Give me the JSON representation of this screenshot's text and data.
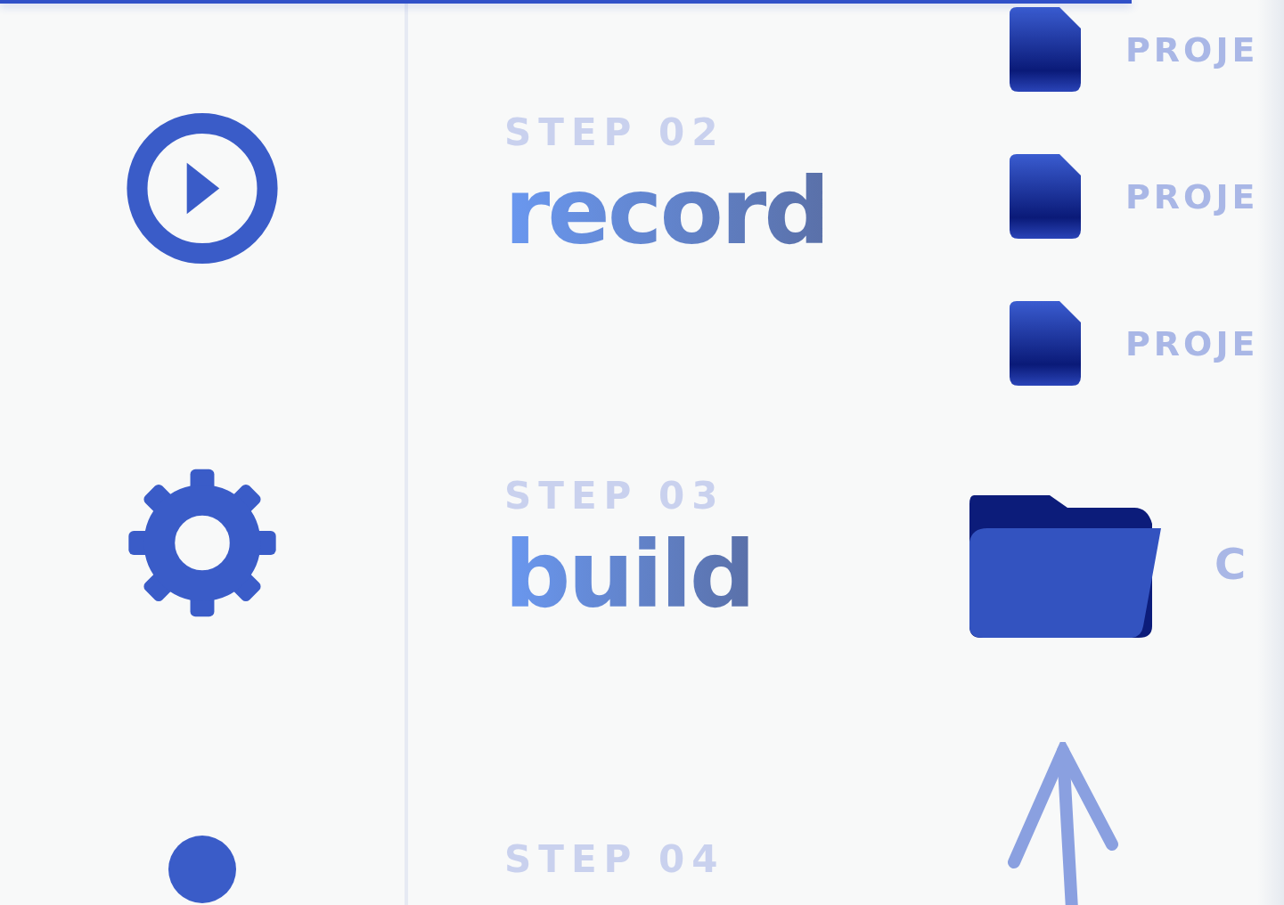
{
  "steps": [
    {
      "label": "STEP 02",
      "title": "record"
    },
    {
      "label": "STEP 03",
      "title": "build"
    },
    {
      "label": "STEP 04"
    }
  ],
  "files": [
    {
      "name": "PROJE"
    },
    {
      "name": "PROJE"
    },
    {
      "name": "PROJE"
    }
  ],
  "folder": {
    "name": "C"
  }
}
